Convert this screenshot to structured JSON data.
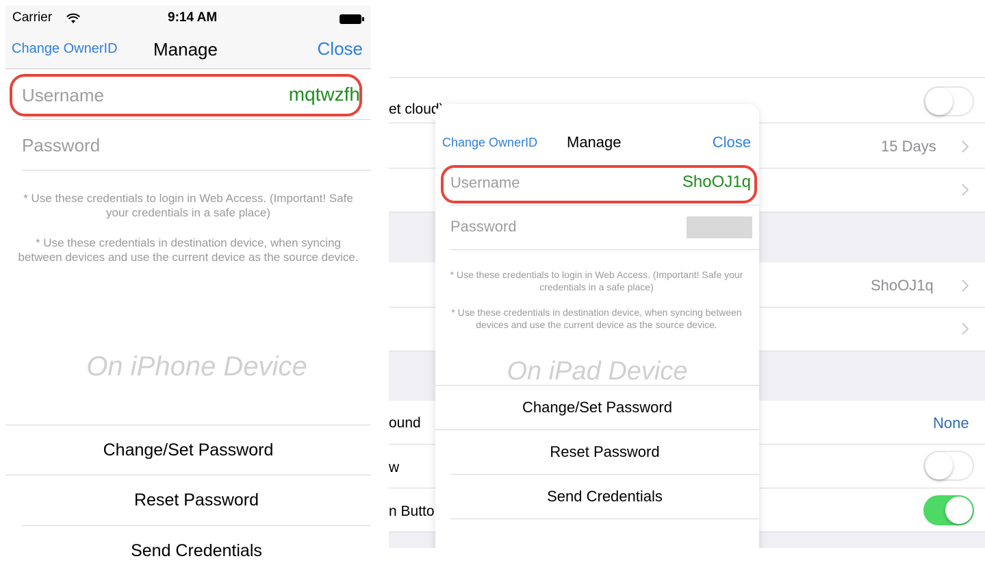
{
  "iphone": {
    "status": {
      "carrier": "Carrier",
      "time": "9:14 AM",
      "wifi_icon": "wifi-icon",
      "battery_icon": "battery-icon"
    },
    "nav": {
      "left": "Change OwnerID",
      "title": "Manage",
      "right": "Close"
    },
    "username_label": "Username",
    "username_value": "mqtwzfh",
    "password_label": "Password",
    "note1": "* Use these credentials to login in Web Access. (Important! Safe your credentials in a safe place)",
    "note2": "* Use these credentials in destination device, when syncing between devices and use the current device as the source device.",
    "device_label": "On iPhone Device",
    "buttons": [
      "Change/Set Password",
      "Reset Password",
      "Send Credentials"
    ]
  },
  "ipad": {
    "background_rows": {
      "row1_text": "et cloud)",
      "row2_value": "15 Days",
      "row4_value": "ShoOJ1q",
      "row6_text": "ound",
      "row6_value": "None",
      "row7_text": "w",
      "row8_text": "n Butto"
    },
    "toggles": {
      "row1": "off",
      "row7": "off",
      "row8": "on"
    },
    "popover": {
      "nav": {
        "left": "Change OwnerID",
        "title": "Manage",
        "right": "Close"
      },
      "username_label": "Username",
      "username_value": "ShoOJ1q",
      "password_label": "Password",
      "note1": "* Use these credentials to login in Web Access. (Important! Safe your credentials in a safe place)",
      "note2": "* Use these credentials in destination device, when syncing between devices and use the current device as the source device.",
      "device_label": "On iPad Device",
      "buttons": [
        "Change/Set Password",
        "Reset Password",
        "Send Credentials"
      ]
    }
  },
  "colors": {
    "link": "#2f80d9",
    "value_green": "#1e8e1e",
    "highlight": "#e8443a",
    "toggle_on": "#4cd964"
  }
}
